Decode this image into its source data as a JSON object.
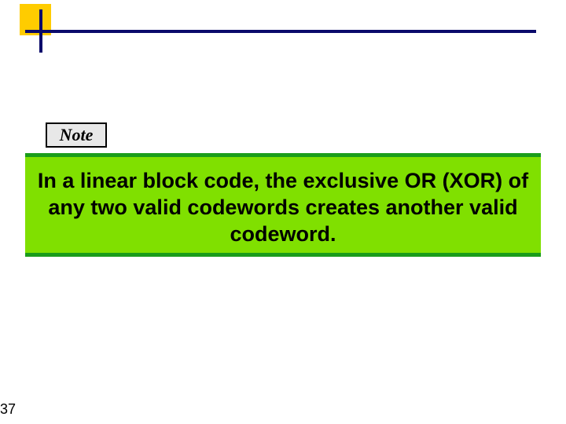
{
  "note": {
    "label": "Note"
  },
  "body": {
    "text": "In a linear block code, the exclusive OR (XOR) of any two valid codewords creates another valid codeword."
  },
  "page": {
    "number": "37"
  }
}
